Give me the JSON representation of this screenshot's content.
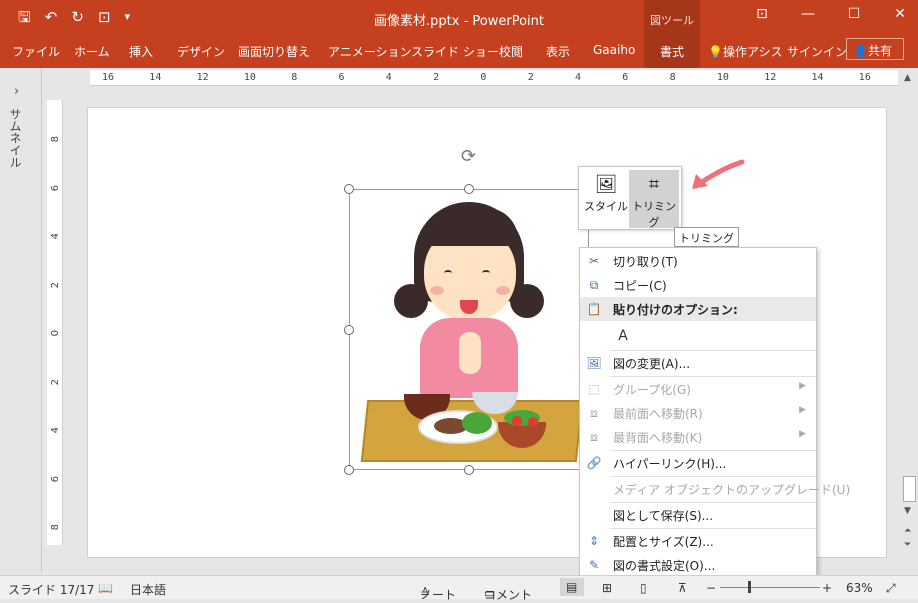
{
  "window": {
    "title": "画像素材.pptx - PowerPoint",
    "tool_context_label": "図ツール",
    "controls": [
      "ribbon-display-icon",
      "minimize-icon",
      "maximize-icon",
      "close-icon"
    ]
  },
  "qat": {
    "save": "🖫",
    "undo": "↶",
    "redo": "↻",
    "present": "⊡",
    "customize": "▾"
  },
  "tabs": [
    {
      "label": "ファイル"
    },
    {
      "label": "ホーム"
    },
    {
      "label": "挿入"
    },
    {
      "label": "デザイン"
    },
    {
      "label": "画面切り替え"
    },
    {
      "label": "アニメーション"
    },
    {
      "label": "スライド ショー"
    },
    {
      "label": "校閲"
    },
    {
      "label": "表示"
    },
    {
      "label": "Gaaiho"
    },
    {
      "label": "書式"
    },
    {
      "label": "操作アシス"
    },
    {
      "label": "サインイン"
    }
  ],
  "share_label": "共有",
  "thumbnails_label": "サムネイル",
  "hruler_ticks": [
    "16",
    "14",
    "12",
    "10",
    "8",
    "6",
    "4",
    "2",
    "0",
    "2",
    "4",
    "6",
    "8",
    "10",
    "12",
    "14",
    "16"
  ],
  "vruler_ticks": [
    "8",
    "6",
    "4",
    "2",
    "0",
    "2",
    "4",
    "6",
    "8"
  ],
  "mini_toolbar": {
    "style_label": "スタイル",
    "crop_label": "トリミング",
    "tooltip": "トリミング"
  },
  "context_menu": {
    "items": [
      {
        "label": "切り取り(T)",
        "icon": "scissors-icon",
        "enabled": true
      },
      {
        "label": "コピー(C)",
        "icon": "copy-icon",
        "enabled": true
      },
      {
        "label": "貼り付けのオプション:",
        "icon": "paste-icon",
        "enabled": true,
        "header": true
      },
      {
        "label": "図の変更(A)...",
        "icon": "change-picture-icon",
        "enabled": true
      },
      {
        "label": "グループ化(G)",
        "icon": "group-icon",
        "enabled": false,
        "submenu": true
      },
      {
        "label": "最前面へ移動(R)",
        "icon": "bring-front-icon",
        "enabled": false,
        "submenu": true
      },
      {
        "label": "最背面へ移動(K)",
        "icon": "send-back-icon",
        "enabled": false,
        "submenu": true
      },
      {
        "label": "ハイパーリンク(H)...",
        "icon": "hyperlink-icon",
        "enabled": true
      },
      {
        "label": "メディア オブジェクトのアップグレード(U)",
        "icon": "",
        "enabled": false
      },
      {
        "label": "図として保存(S)...",
        "icon": "",
        "enabled": true
      },
      {
        "label": "配置とサイズ(Z)...",
        "icon": "size-position-icon",
        "enabled": true
      },
      {
        "label": "図の書式設定(O)...",
        "icon": "format-picture-icon",
        "enabled": true
      }
    ],
    "paste_option_glyph": "A"
  },
  "status": {
    "slide": "スライド 17/17",
    "language": "日本語",
    "notes": "ノート",
    "comments": "コメント",
    "zoom": "63%",
    "zoom_minus": "−",
    "zoom_plus": "+"
  },
  "colors": {
    "accent": "#c4401f",
    "accent_dark": "#a5361a",
    "arrow": "#f0707a"
  }
}
